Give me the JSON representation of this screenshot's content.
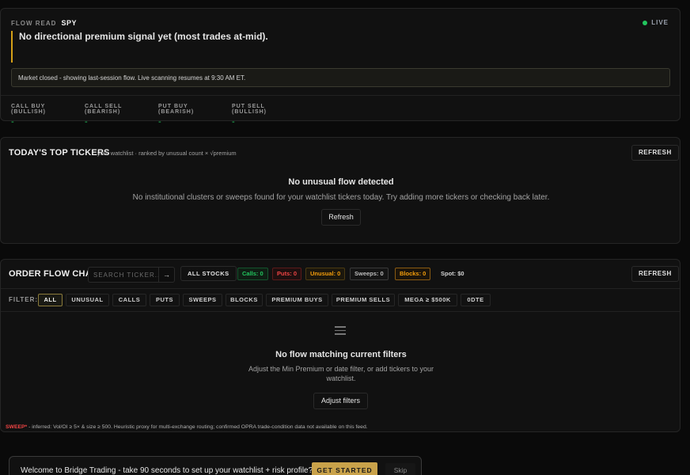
{
  "flow_read": {
    "label": "FLOW READ",
    "ticker": "SPY",
    "live_label": "LIVE",
    "signal": "No directional premium signal yet (most trades at-mid).",
    "market_message": "Market closed - showing last-session flow. Live scanning resumes at 9:30 AM ET.",
    "stats": [
      {
        "label": "CALL BUY (BULLISH)",
        "value": "-"
      },
      {
        "label": "CALL SELL (BEARISH)",
        "value": "-"
      },
      {
        "label": "PUT BUY (BEARISH)",
        "value": "-"
      },
      {
        "label": "PUT SELL (BULLISH)",
        "value": "-"
      }
    ]
  },
  "top_tickers": {
    "title": "TODAY'S TOP TICKERS",
    "subtitle": "your watchlist · ranked by unusual count × √premium",
    "refresh_label": "REFRESH",
    "empty_title": "No unusual flow detected",
    "empty_desc": "No institutional clusters or sweeps found for your watchlist tickers today. Try adding more tickers or checking back later.",
    "empty_button": "Refresh"
  },
  "order_flow": {
    "title": "ORDER FLOW CHAIN",
    "search_placeholder": "SEARCH TICKER...",
    "search_go": "→",
    "all_stocks_label": "All Stocks",
    "chips": {
      "calls": "Calls: 0",
      "puts": "Puts: 0",
      "unusual": "Unusual: 0",
      "sweeps": "Sweeps: 0",
      "blocks": "Blocks: 0",
      "spot": "Spot: $0"
    },
    "refresh_label": "REFRESH",
    "filter_label": "FILTER:",
    "filters": [
      "ALL",
      "UNUSUAL",
      "CALLS",
      "PUTS",
      "SWEEPS",
      "BLOCKS",
      "PREMIUM BUYS",
      "PREMIUM SELLS",
      "MEGA ≥ $500K",
      "0DTE"
    ],
    "active_filter": "ALL",
    "empty_title": "No flow matching current filters",
    "empty_desc_line1": "Adjust the Min Premium or date filter, or add tickers to your",
    "empty_desc_line2": "watchlist.",
    "adjust_button": "Adjust filters",
    "footnote_key": "SWEEP*",
    "footnote_text": " - inferred: Vol/OI ≥ 5× & size ≥ 500. Heuristic proxy for multi-exchange routing; confirmed OPRA trade-condition data not available on this feed."
  },
  "welcome": {
    "text": "Welcome to Bridge Trading - take 90 seconds to set up your watchlist + risk profile?",
    "start_label": "GET STARTED",
    "skip_label": "Skip"
  },
  "colors": {
    "accent_gold": "#d4a017",
    "live_green": "#22c55e",
    "calls_green": "#22c55e",
    "puts_red": "#ef4444",
    "unusual_amber": "#f59e0b",
    "blocks_orange": "#f59e0b"
  }
}
